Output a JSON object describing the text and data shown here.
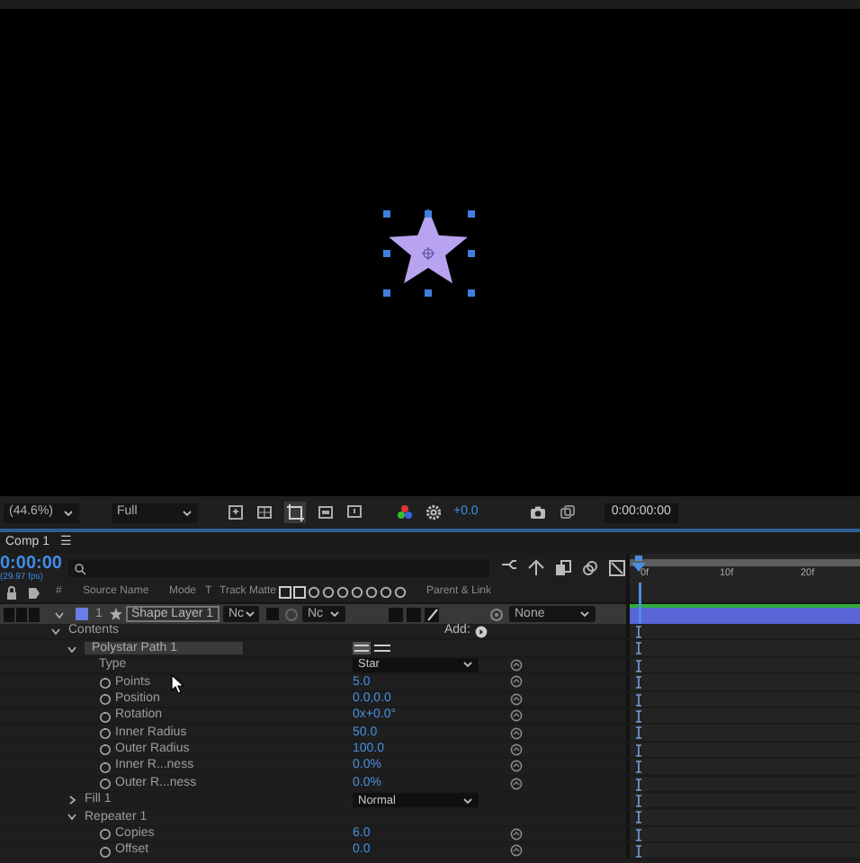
{
  "viewer_toolbar": {
    "zoom": "(44.6%)",
    "resolution": "Full",
    "exposure": "+0.0",
    "timecode": "0:00:00:00"
  },
  "panel_tab": {
    "label": "Comp 1",
    "menu": "☰"
  },
  "timeline": {
    "timecode": "0:00:00",
    "fps": "(29.97 fps)",
    "ruler": [
      "0f",
      "10f",
      "20f"
    ]
  },
  "columns": {
    "number": "#",
    "source_name": "Source Name",
    "mode": "Mode",
    "t": "T",
    "track_matte": "Track Matte",
    "parent": "Parent & Link"
  },
  "layer": {
    "number": "1",
    "name": "Shape Layer 1",
    "mode": "Nc",
    "track_matte": "Nc",
    "parent": "None",
    "selected": true,
    "expanded": true
  },
  "contents": {
    "label": "Contents",
    "add_label": "Add:",
    "expanded": true,
    "children": [
      {
        "kind": "group",
        "label": "Polystar Path 1",
        "expanded": true,
        "selected": true,
        "children": [
          {
            "kind": "dropdown",
            "label": "Type",
            "value": "Star"
          },
          {
            "kind": "number",
            "label": "Points",
            "value": "5.0"
          },
          {
            "kind": "number",
            "label": "Position",
            "value": "0.0,0.0"
          },
          {
            "kind": "number",
            "label": "Rotation",
            "value": "0x+0.0°"
          },
          {
            "kind": "number",
            "label": "Inner Radius",
            "value": "50.0"
          },
          {
            "kind": "number",
            "label": "Outer Radius",
            "value": "100.0"
          },
          {
            "kind": "number",
            "label": "Inner R...ness",
            "value": "0.0%"
          },
          {
            "kind": "number",
            "label": "Outer R...ness",
            "value": "0.0%"
          }
        ]
      },
      {
        "kind": "group",
        "label": "Fill 1",
        "expanded": false,
        "selected": false,
        "value": "Normal"
      },
      {
        "kind": "group",
        "label": "Repeater 1",
        "expanded": true,
        "selected": false,
        "children": [
          {
            "kind": "number",
            "label": "Copies",
            "value": "6.0"
          },
          {
            "kind": "number",
            "label": "Offset",
            "value": "0.0"
          }
        ]
      }
    ]
  }
}
